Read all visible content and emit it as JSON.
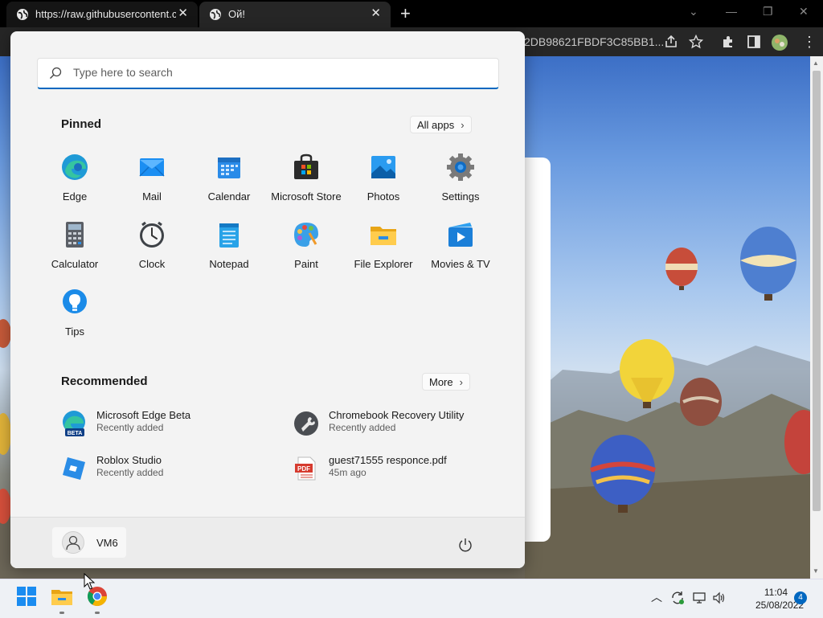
{
  "browser": {
    "tabs": [
      {
        "title": "https://raw.githubusercontent.com/",
        "close": "✕"
      },
      {
        "title": "Ой!",
        "close": "✕"
      }
    ],
    "new_tab": "+",
    "url_fragment": "2DB98621FBDF3C85BB1..."
  },
  "start_menu": {
    "search_placeholder": "Type here to search",
    "pinned_title": "Pinned",
    "all_apps_label": "All apps",
    "pinned": [
      {
        "label": "Edge",
        "icon": "edge-icon"
      },
      {
        "label": "Mail",
        "icon": "mail-icon"
      },
      {
        "label": "Calendar",
        "icon": "calendar-icon"
      },
      {
        "label": "Microsoft Store",
        "icon": "store-icon"
      },
      {
        "label": "Photos",
        "icon": "photos-icon"
      },
      {
        "label": "Settings",
        "icon": "settings-icon"
      },
      {
        "label": "Calculator",
        "icon": "calculator-icon"
      },
      {
        "label": "Clock",
        "icon": "clock-icon"
      },
      {
        "label": "Notepad",
        "icon": "notepad-icon"
      },
      {
        "label": "Paint",
        "icon": "paint-icon"
      },
      {
        "label": "File Explorer",
        "icon": "folder-icon"
      },
      {
        "label": "Movies & TV",
        "icon": "movies-icon"
      },
      {
        "label": "Tips",
        "icon": "tips-icon"
      }
    ],
    "recommended_title": "Recommended",
    "more_label": "More",
    "recommended": [
      {
        "name": "Microsoft Edge Beta",
        "sub": "Recently added",
        "icon": "edge-beta-icon",
        "badge": "BETA"
      },
      {
        "name": "Chromebook Recovery Utility",
        "sub": "Recently added",
        "icon": "recovery-icon"
      },
      {
        "name": "Roblox Studio",
        "sub": "Recently added",
        "icon": "roblox-icon"
      },
      {
        "name": "guest71555 responce.pdf",
        "sub": "45m ago",
        "icon": "pdf-icon",
        "badge": "PDF"
      }
    ],
    "user_name": "VM6"
  },
  "taskbar": {
    "time": "11:04",
    "date": "25/08/2022",
    "notification_count": "4"
  },
  "colors": {
    "accent": "#0067c0",
    "start_bg": "#f3f3f3",
    "taskbar_bg": "#eef1f5"
  }
}
